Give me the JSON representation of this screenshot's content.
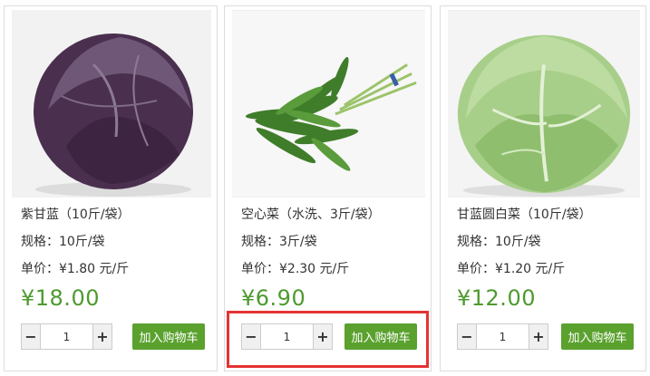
{
  "products": [
    {
      "name": "紫甘蓝（10斤/袋）",
      "spec": "规格：10斤/袋",
      "unit_price": "单价：¥1.80 元/斤",
      "price": "¥18.00",
      "quantity": "1",
      "cart_label": "加入购物车",
      "image": "red-cabbage-photo"
    },
    {
      "name": "空心菜（水洗、3斤/袋）",
      "spec": "规格：3斤/袋",
      "unit_price": "单价：¥2.30 元/斤",
      "price": "¥6.90",
      "quantity": "1",
      "cart_label": "加入购物车",
      "image": "water-spinach-photo"
    },
    {
      "name": "甘蓝圆白菜（10斤/袋）",
      "spec": "规格：10斤/袋",
      "unit_price": "单价：¥1.20 元/斤",
      "price": "¥12.00",
      "quantity": "1",
      "cart_label": "加入购物车",
      "image": "green-cabbage-photo"
    }
  ],
  "controls": {
    "minus": "−",
    "plus": "+"
  },
  "colors": {
    "price": "#4e9a2f",
    "cart_button": "#5aa12e",
    "highlight": "#e53333"
  }
}
